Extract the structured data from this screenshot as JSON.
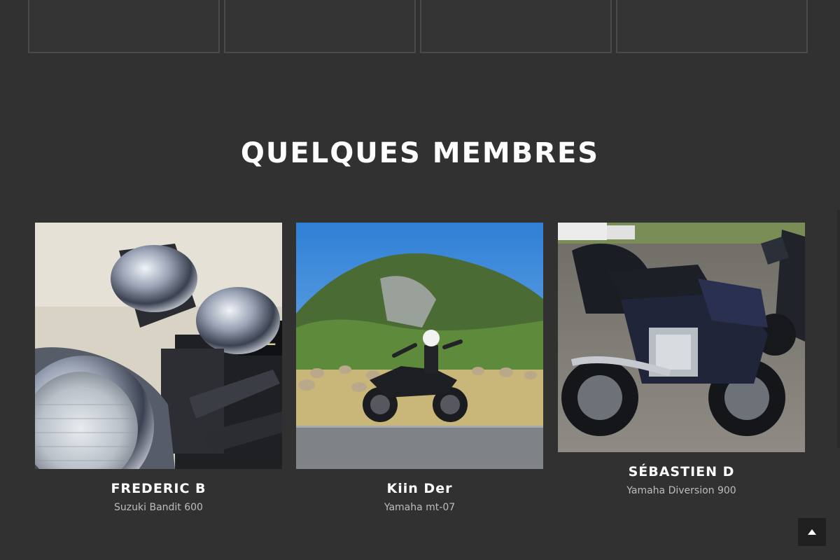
{
  "section": {
    "title": "QUELQUES MEMBRES"
  },
  "members": [
    {
      "name": "FREDERIC B",
      "bike": "Suzuki Bandit 600",
      "photo_icon": "chrome-headlights-photo"
    },
    {
      "name": "Kiin Der",
      "bike": "Yamaha mt-07",
      "photo_icon": "rider-on-motorcycle-photo"
    },
    {
      "name": "SÉBASTIEN D",
      "bike": "Yamaha Diversion 900",
      "photo_icon": "touring-motorcycle-photo"
    }
  ],
  "back_to_top": {
    "icon": "caret-up-icon"
  },
  "colors": {
    "background": "#313131",
    "title": "#ffffff",
    "subtitle": "#bdbdbd",
    "button_bg": "#202020"
  }
}
